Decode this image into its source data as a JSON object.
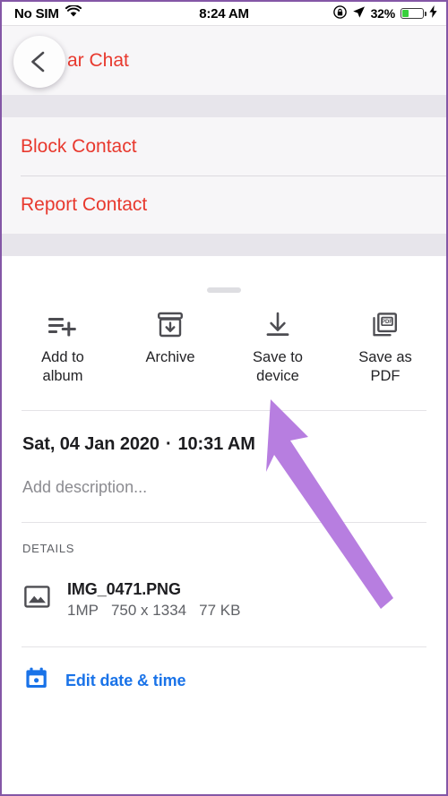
{
  "status_bar": {
    "carrier": "No SIM",
    "wifi_icon": "wifi-icon",
    "time": "8:24 AM",
    "rotation_lock_icon": "rotation-lock-icon",
    "location_icon": "location-arrow-icon",
    "battery_percent": "32%",
    "battery_icon": "battery-charging-icon",
    "battery_level": 32,
    "battery_color": "#39d03c"
  },
  "background_menu": {
    "back_button_icon": "chevron-left-icon",
    "partial_title": "ar Chat",
    "destructive_color": "#e8392e",
    "items": [
      {
        "label": "Block Contact"
      },
      {
        "label": "Report Contact"
      }
    ]
  },
  "sheet": {
    "handle": "drag-handle",
    "actions": [
      {
        "label": "Add to\nalbum",
        "icon": "playlist-add-icon"
      },
      {
        "label": "Archive",
        "icon": "archive-icon"
      },
      {
        "label": "Save to\ndevice",
        "icon": "download-icon"
      },
      {
        "label": "Save as PDF",
        "icon": "pdf-icon"
      }
    ],
    "date": "Sat, 04 Jan 2020",
    "date_separator": "·",
    "time": "10:31 AM",
    "description_placeholder": "Add description...",
    "details_header": "DETAILS",
    "file": {
      "icon": "image-icon",
      "name": "IMG_0471.PNG",
      "megapixels": "1MP",
      "dimensions": "750 x 1334",
      "size": "77 KB"
    },
    "edit_date_time": {
      "icon": "calendar-icon",
      "label": "Edit date & time",
      "color": "#1a73e8"
    }
  },
  "annotation": {
    "arrow_icon": "pointer-arrow-annotation",
    "color": "#b77ee0",
    "points_to": "Save to device"
  }
}
